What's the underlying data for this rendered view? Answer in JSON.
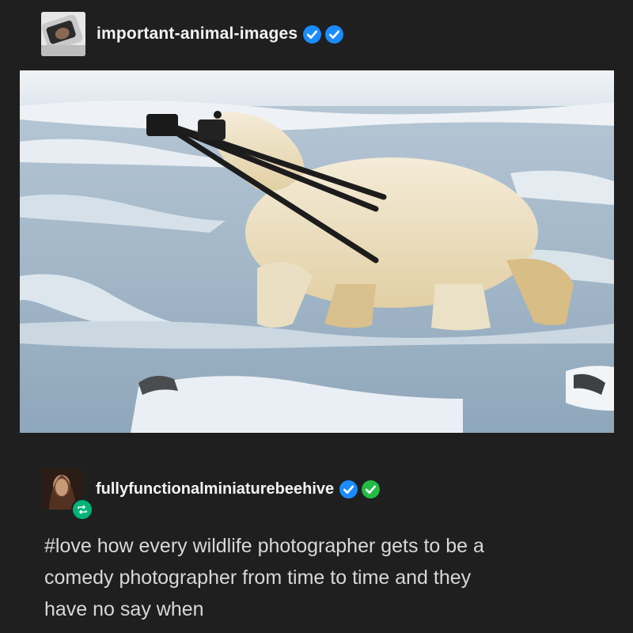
{
  "original_post": {
    "username": "important-animal-images",
    "avatar_icon": "user-avatar-icon",
    "badges": [
      {
        "icon": "verified-check-icon",
        "color": "#1a8cff"
      },
      {
        "icon": "verified-check-icon",
        "color": "#1a8cff"
      }
    ],
    "image": {
      "icon": "polar-bear-photo",
      "description_colors": {
        "snow": "#eef2f6",
        "ice": "#a9bccb",
        "bear": "#efe6cf",
        "tripod": "#1c1c1c"
      }
    }
  },
  "reblog": {
    "username": "fullyfunctionalminiaturebeehive",
    "reblog_icon": "reblog-icon",
    "badges": [
      {
        "icon": "verified-check-icon",
        "color": "#1a8cff"
      },
      {
        "icon": "verified-check-icon",
        "color": "#22bb44"
      }
    ],
    "text_lines": [
      "#love how every wildlife photographer gets to be a",
      "comedy photographer from time to time and they",
      "have no say when"
    ]
  },
  "colors": {
    "background": "#1f1f20",
    "reblog_green": "#00b377"
  }
}
